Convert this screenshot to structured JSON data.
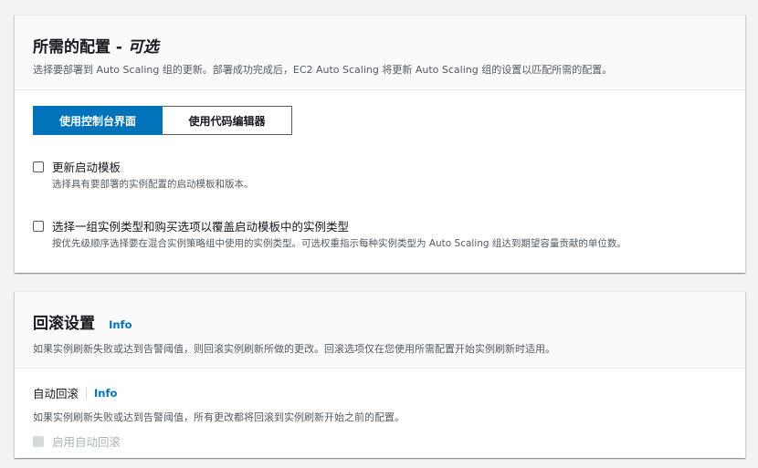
{
  "desired_config": {
    "title": "所需的配置 -",
    "title_optional": "可选",
    "description": "选择要部署到 Auto Scaling 组的更新。部署成功完成后，EC2 Auto Scaling 将更新 Auto Scaling 组的设置以匹配所需的配置。",
    "segment": {
      "console_label": "使用控制台界面",
      "code_editor_label": "使用代码编辑器"
    },
    "options": [
      {
        "label": "更新启动模板",
        "description": "选择具有要部署的实例配置的启动模板和版本。"
      },
      {
        "label": "选择一组实例类型和购买选项以覆盖启动模板中的实例类型",
        "description": "按优先级顺序选择要在混合实例策略组中使用的实例类型。可选权重指示每种实例类型为 Auto Scaling 组达到期望容量贡献的单位数。"
      }
    ]
  },
  "rollback": {
    "title": "回滚设置",
    "info": "Info",
    "description": "如果实例刷新失败或达到告警阈值，则回滚实例刷新所做的更改。回滚选项仅在您使用所需配置开始实例刷新时适用。",
    "auto_rollback": {
      "label": "自动回滚",
      "info": "Info",
      "description": "如果实例刷新失败或达到告警阈值，所有更改都将回滚到实例刷新开始之前的配置。",
      "checkbox_label": "启用自动回滚"
    }
  },
  "colors": {
    "accent": "#0073bb",
    "page_bg": "#f2f3f3",
    "header_bg": "#fafafa",
    "muted_text": "#545b64",
    "disabled": "#aab7b8"
  }
}
